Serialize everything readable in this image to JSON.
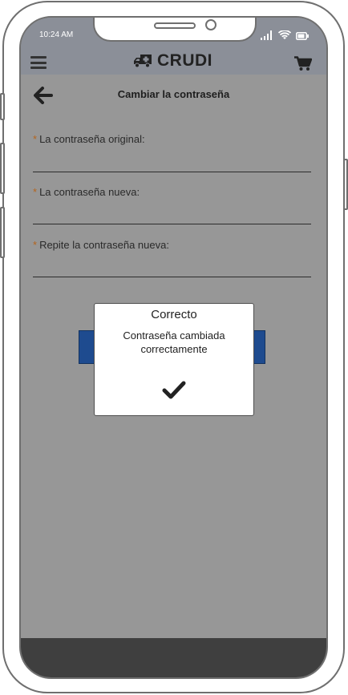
{
  "status_bar": {
    "time": "10:24 AM"
  },
  "header": {
    "brand": "CRUDI"
  },
  "page": {
    "title": "Cambiar la contraseña"
  },
  "form": {
    "required_mark": "*",
    "fields": [
      {
        "label": "La contraseña original:",
        "value": ""
      },
      {
        "label": "La contraseña nueva:",
        "value": ""
      },
      {
        "label": "Repite la contraseña nueva:",
        "value": ""
      }
    ]
  },
  "dialog": {
    "title": "Correcto",
    "message": "Contraseña cambiada correctamente"
  },
  "colors": {
    "header_bg": "#8b8f98",
    "screen_bg": "#979797",
    "primary_button": "#1e4b8f",
    "bottom_bar": "#3f3f3f",
    "required_mark": "#b5651d"
  },
  "icons": {
    "menu": "hamburger-icon",
    "brand": "truck-icon",
    "cart": "cart-icon",
    "back": "arrow-left-icon",
    "dialog": "check-icon"
  }
}
